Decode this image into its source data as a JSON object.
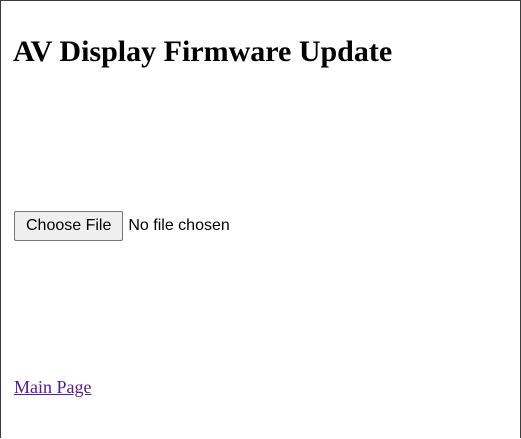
{
  "page": {
    "title": "AV Display Firmware Update"
  },
  "file_input": {
    "button_label": "Choose File",
    "status_text": "No file chosen"
  },
  "links": {
    "main_page": "Main Page"
  },
  "colors": {
    "visited_link": "#551a8b",
    "button_background": "#efefef",
    "button_border": "#767676",
    "text": "#000000"
  }
}
